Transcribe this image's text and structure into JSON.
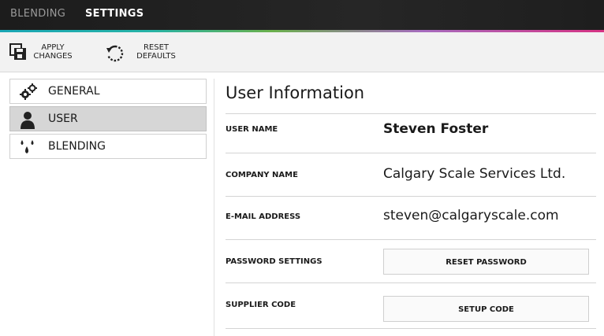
{
  "top_tabs": {
    "blending": "BLENDING",
    "settings": "SETTINGS"
  },
  "toolbar": {
    "apply_label": "APPLY\nCHANGES",
    "reset_label": "RESET\nDEFAULTS"
  },
  "sidebar": {
    "items": [
      {
        "label": "GENERAL",
        "icon": "gears-icon",
        "active": false
      },
      {
        "label": "USER",
        "icon": "user-icon",
        "active": true
      },
      {
        "label": "BLENDING",
        "icon": "droplets-icon",
        "active": false
      }
    ]
  },
  "main": {
    "title": "User Information",
    "rows": {
      "user_name": {
        "label": "USER NAME",
        "value": "Steven Foster"
      },
      "company_name": {
        "label": "COMPANY NAME",
        "value": "Calgary Scale Services Ltd."
      },
      "email": {
        "label": "E-MAIL ADDRESS",
        "value": "steven@calgaryscale.com"
      },
      "password": {
        "label": "PASSWORD SETTINGS",
        "button": "RESET PASSWORD"
      },
      "supplier": {
        "label": "SUPPLIER CODE",
        "button": "SETUP CODE"
      }
    }
  },
  "colors": {
    "topbar": "#1e1e1e",
    "accent_start": "#1aa6b5",
    "accent_end": "#d63384",
    "active_item": "#d6d6d6"
  }
}
